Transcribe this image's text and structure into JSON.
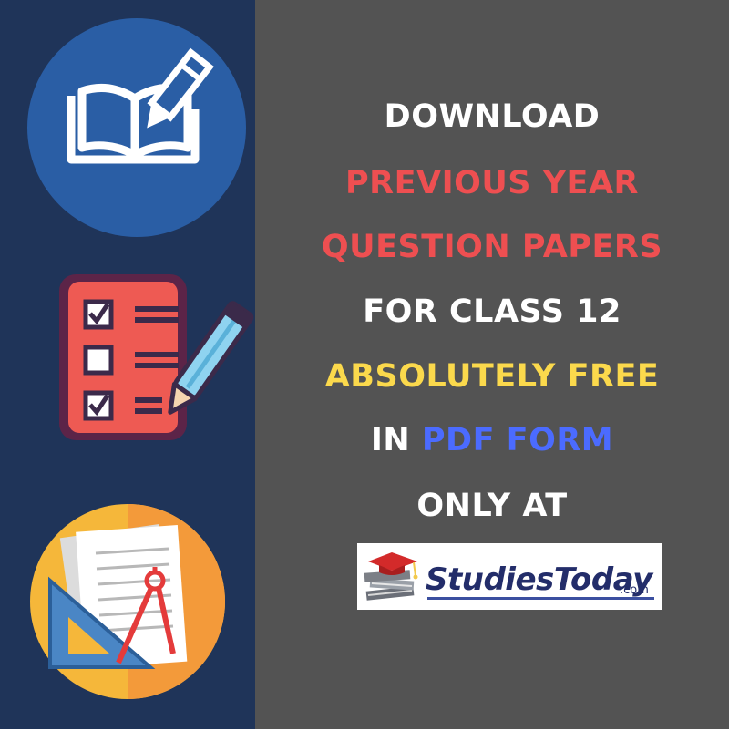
{
  "icons": {
    "book": "book-pencil-icon",
    "checklist": "checklist-icon",
    "geometry": "geometry-tools-icon"
  },
  "colors": {
    "left_bg": "#1f3459",
    "right_bg": "#535353",
    "white_text": "#ffffff",
    "red_text": "#ee4f51",
    "yellow_text": "#fbd94c",
    "blue_text": "#4b6bff"
  },
  "headline": {
    "line1": "DOWNLOAD",
    "line2": "PREVIOUS YEAR",
    "line3": "QUESTION PAPERS",
    "line4": "FOR CLASS 12",
    "line5": "ABSOLUTELY FREE",
    "line6_prefix": "IN ",
    "line6_highlight": "PDF FORM",
    "line7": "ONLY AT"
  },
  "logo": {
    "name": "StudiesToday",
    "suffix": ".com"
  }
}
